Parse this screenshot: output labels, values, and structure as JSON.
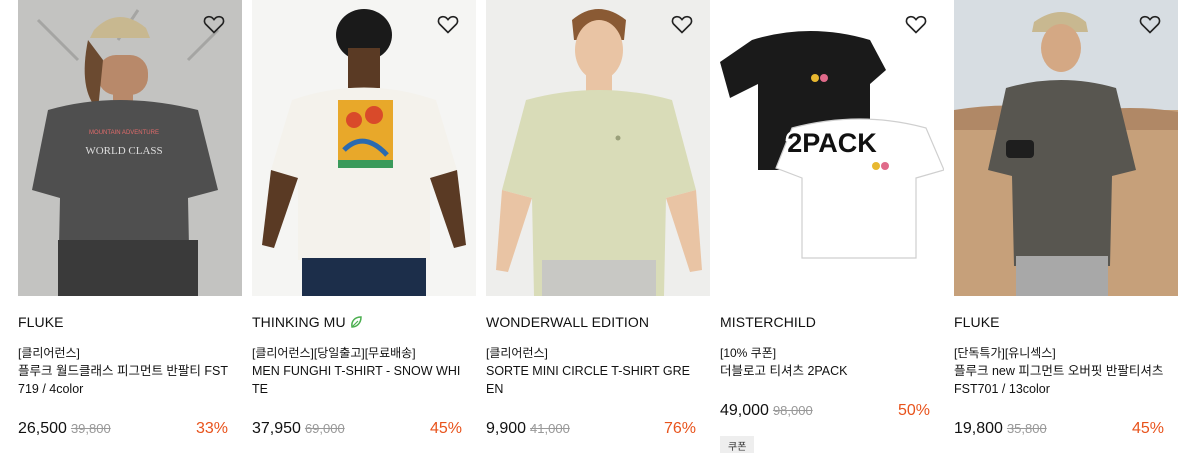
{
  "products": [
    {
      "brand": "FLUKE",
      "tags": "[클리어런스]",
      "name": "플루크 월드클래스 피그먼트 반팔티 FST719 / 4color",
      "price": "26,500",
      "original_price": "39,800",
      "discount": "33%",
      "print_line1": "MOUNTAIN ADVENTURE",
      "print_line2": "WORLD CLASS"
    },
    {
      "brand": "THINKING MU",
      "tags": "[클리어런스][당일출고][무료배송]",
      "name": "MEN FUNGHI T-SHIRT - SNOW WHITE",
      "price": "37,950",
      "original_price": "69,000",
      "discount": "45%"
    },
    {
      "brand": "WONDERWALL EDITION",
      "tags": "[클리어런스]",
      "name": "SORTE MINI CIRCLE T-SHIRT GREEN",
      "price": "9,900",
      "original_price": "41,000",
      "discount": "76%"
    },
    {
      "brand": "MISTERCHILD",
      "tags": "[10% 쿠폰]",
      "name": "더블로고 티셔츠 2PACK",
      "price": "49,000",
      "original_price": "98,000",
      "discount": "50%",
      "coupon": "쿠폰",
      "overlay_text": "2PACK"
    },
    {
      "brand": "FLUKE",
      "tags": "[단독특가][유니섹스]",
      "name": "플루크 new 피그먼트 오버핏 반팔티셔츠 FST701 / 13color",
      "price": "19,800",
      "original_price": "35,800",
      "discount": "45%"
    }
  ],
  "colors": {
    "discount": "#e8531c",
    "strike": "#999999",
    "leaf": "#4caf50"
  },
  "icons": {
    "wishlist": "heart-outline-icon",
    "eco_badge": "leaf-icon"
  }
}
